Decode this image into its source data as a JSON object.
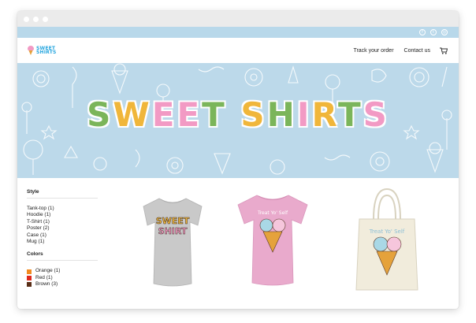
{
  "window": {
    "dots": 3
  },
  "topbar": {
    "social": [
      {
        "name": "facebook-icon",
        "glyph": "f"
      },
      {
        "name": "twitter-icon",
        "glyph": "t"
      },
      {
        "name": "instagram-icon",
        "glyph": "◎"
      }
    ]
  },
  "header": {
    "logo_line1": "SWEET",
    "logo_line2": "SHIRTS",
    "nav": {
      "track": "Track your order",
      "contact": "Contact us"
    },
    "cart_icon": "cart-icon"
  },
  "hero": {
    "title_word1": "SWEET",
    "title_word2": "SHIRTS",
    "colors": {
      "background": "#bcd9ea",
      "letters": [
        "#7bb55a",
        "#f0b63a",
        "#f29ac4",
        "#f29ac4",
        "#7bb55a",
        "#f0b63a",
        "#7bb55a",
        "#f29ac4",
        "#f0b63a",
        "#7bb55a",
        "#f29ac4"
      ]
    }
  },
  "sidebar": {
    "style_title": "Style",
    "styles": [
      "Tank-top (1)",
      "Hoodie (1)",
      "T-Shirt (1)",
      "Poster (2)",
      "Case (1)",
      "Mug (1)"
    ],
    "colors_title": "Colors",
    "colors": [
      {
        "label": "Orange (1)",
        "hex": "#f28a1f"
      },
      {
        "label": "Red (1)",
        "hex": "#e0281c"
      },
      {
        "label": "Brown (3)",
        "hex": "#5a2e17"
      }
    ]
  },
  "products": [
    {
      "name": "grey-womens-tshirt",
      "print_line1": "SWEET",
      "print_line2": "SHIRT",
      "color": "#c9c9c9"
    },
    {
      "name": "pink-tshirt",
      "print_line1": "Treat Yo' Self",
      "color": "#e9aacc"
    },
    {
      "name": "tote-bag",
      "print_line1": "Treat Yo' Self",
      "color": "#f1ecdc"
    }
  ]
}
